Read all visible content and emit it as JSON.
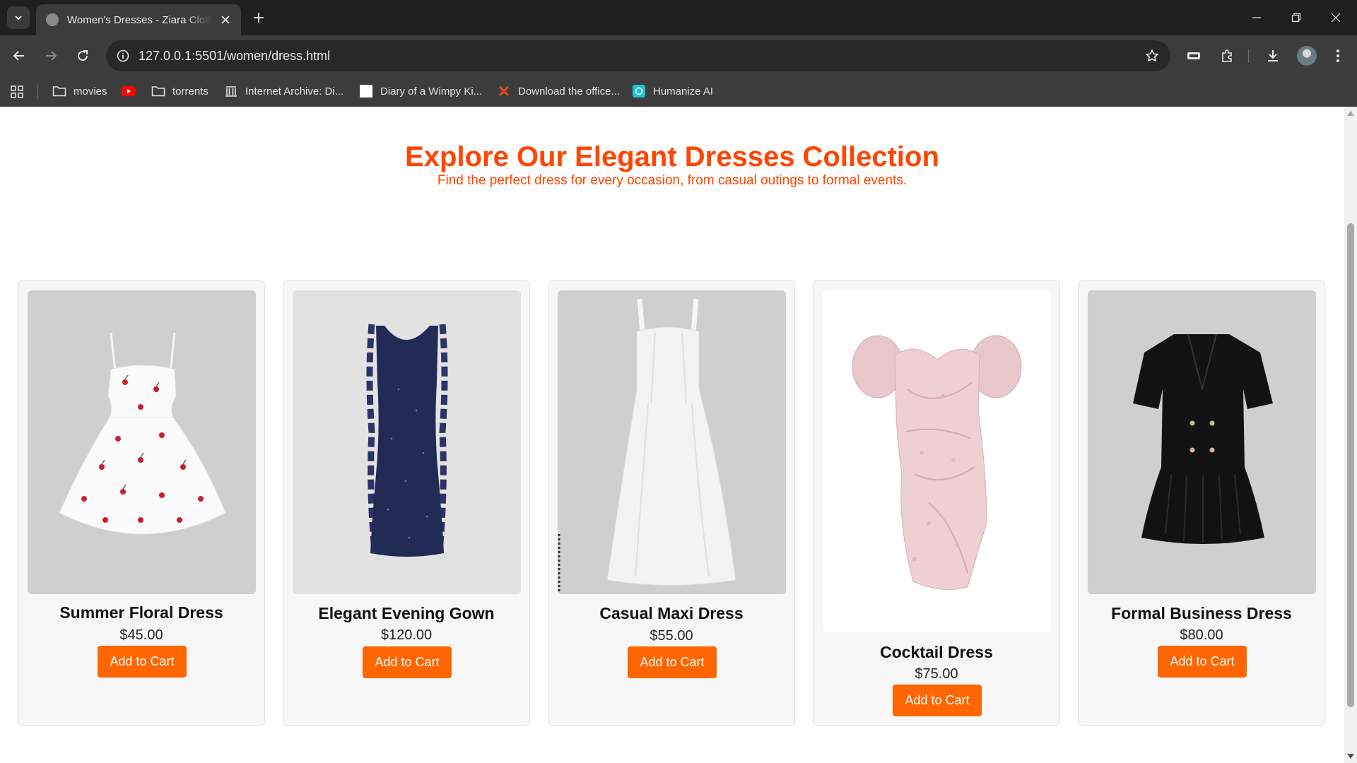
{
  "browser": {
    "tab_title": "Women's Dresses - Ziara Clothing",
    "url": "127.0.0.1:5501/women/dress.html",
    "bookmarks": [
      {
        "label": "movies",
        "icon": "folder-icon"
      },
      {
        "label": "",
        "icon": "youtube-icon"
      },
      {
        "label": "torrents",
        "icon": "folder-icon"
      },
      {
        "label": "Internet Archive: Di...",
        "icon": "archive-icon"
      },
      {
        "label": "Diary of a Wimpy Ki...",
        "icon": "page-icon"
      },
      {
        "label": "Download the office...",
        "icon": "x-logo-icon"
      },
      {
        "label": "Humanize AI",
        "icon": "humanize-icon"
      }
    ]
  },
  "hero": {
    "title": "Explore Our Elegant Dresses Collection",
    "subtitle": "Find the perfect dress for every occasion, from casual outings to formal events."
  },
  "products": [
    {
      "name": "Summer Floral Dress",
      "price": "$45.00",
      "button": "Add to Cart",
      "image": "white-cherry-print-dress"
    },
    {
      "name": "Elegant Evening Gown",
      "price": "$120.00",
      "button": "Add to Cart",
      "image": "navy-ruffle-gown"
    },
    {
      "name": "Casual Maxi Dress",
      "price": "$55.00",
      "button": "Add to Cart",
      "image": "white-maxi-dress"
    },
    {
      "name": "Cocktail Dress",
      "price": "$75.00",
      "button": "Add to Cart",
      "image": "pink-puff-sleeve-dress"
    },
    {
      "name": "Formal Business Dress",
      "price": "$80.00",
      "button": "Add to Cart",
      "image": "black-blazer-dress"
    }
  ],
  "colors": {
    "accent": "#ff4500",
    "button": "#ff6600"
  }
}
